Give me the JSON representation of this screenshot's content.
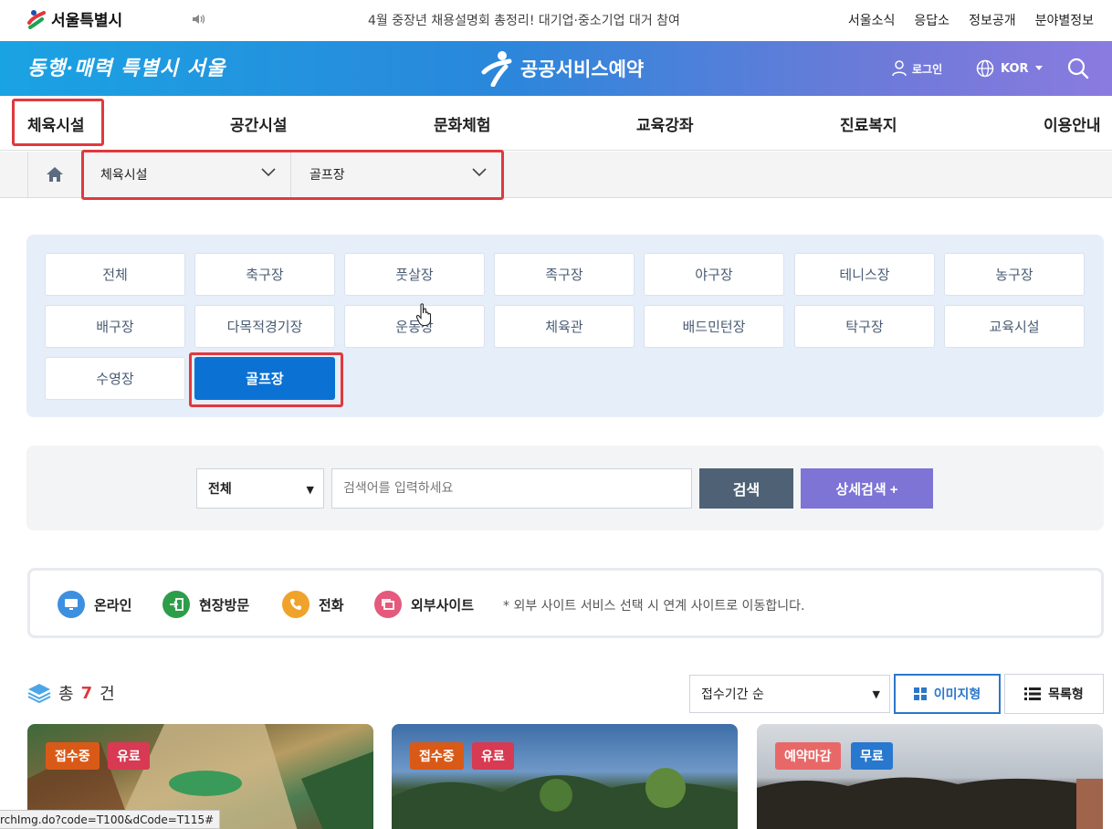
{
  "topbar": {
    "logo_text": "서울특별시",
    "ticker": "4월 중장년 채용설명회 총정리! 대기업·중소기업 대거 참여",
    "links": [
      "서울소식",
      "응답소",
      "정보공개",
      "분야별정보"
    ]
  },
  "banner": {
    "slogan": "동행·매력 특별시 서울",
    "brand": "공공서비스예약",
    "login": "로그인",
    "lang": "KOR"
  },
  "gnb": [
    "체육시설",
    "공간시설",
    "문화체험",
    "교육강좌",
    "진료복지",
    "이용안내"
  ],
  "location": {
    "depth1": "체육시설",
    "depth2": "골프장"
  },
  "categories": [
    "전체",
    "축구장",
    "풋살장",
    "족구장",
    "야구장",
    "테니스장",
    "농구장",
    "배구장",
    "다목적경기장",
    "운동장",
    "체육관",
    "배드민턴장",
    "탁구장",
    "교육시설",
    "수영장",
    "골프장"
  ],
  "active_category": "골프장",
  "search": {
    "scope": "전체",
    "placeholder": "검색어를 입력하세요",
    "button": "검색",
    "advanced": "상세검색 +"
  },
  "legend": {
    "items": [
      "온라인",
      "현장방문",
      "전화",
      "외부사이트"
    ],
    "note": "* 외부 사이트 서비스 선택 시 연계 사이트로 이동합니다."
  },
  "results": {
    "total_prefix": "총",
    "total": "7",
    "total_suffix": "건",
    "sort": "접수기간 순",
    "view_image": "이미지형",
    "view_list": "목록형"
  },
  "cards": [
    {
      "status": "접수중",
      "fee": "유료"
    },
    {
      "status": "접수중",
      "fee": "유료"
    },
    {
      "status": "예약마감",
      "fee": "무료"
    }
  ],
  "statusbar": "rchImg.do?code=T100&dCode=T115#",
  "colors": {
    "accent": "#0b72d3",
    "highlight": "#e0393e",
    "search_button": "#4f6175",
    "advanced_button": "#7d74d6"
  }
}
